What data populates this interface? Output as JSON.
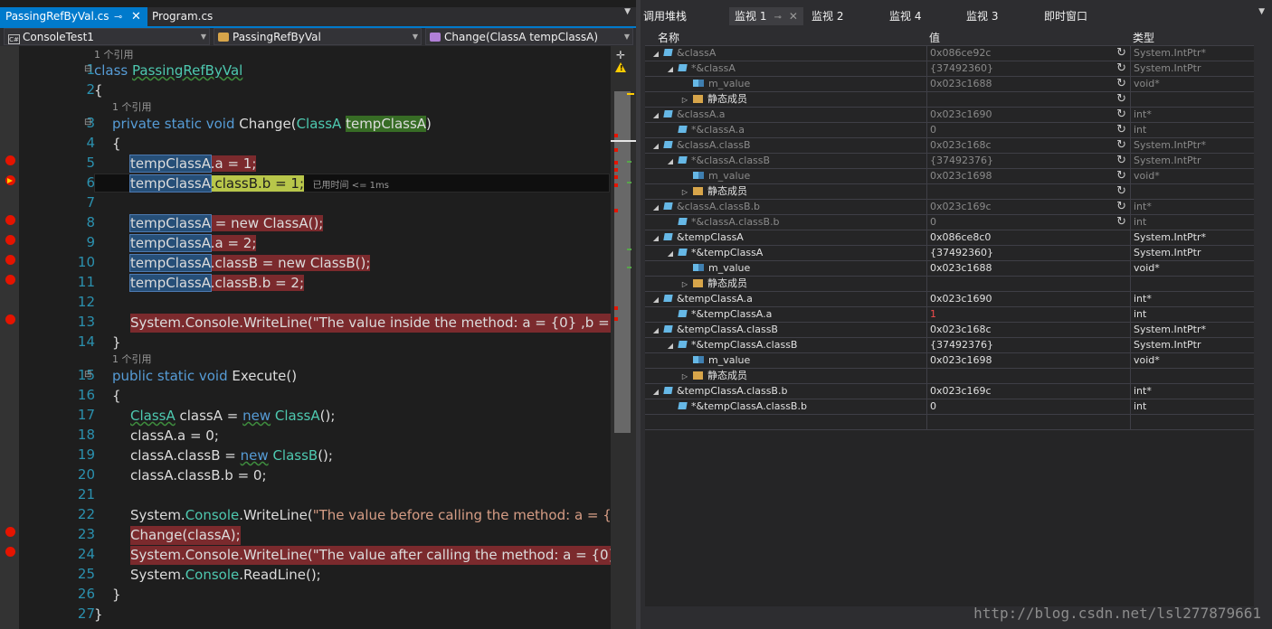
{
  "editor": {
    "tabs": [
      {
        "label": "PassingRefByVal.cs",
        "active": true
      },
      {
        "label": "Program.cs",
        "active": false
      }
    ],
    "tab_pin_icon": "pin-icon",
    "tab_close_icon": "close-icon",
    "nav": {
      "project": "ConsoleTest1",
      "class": "PassingRefByVal",
      "member": "Change(ClassA tempClassA)"
    },
    "ref_hint": "1 个引用",
    "elapsed_hint": "已用时间 <= 1ms",
    "line_numbers": [
      "1",
      "2",
      "3",
      "4",
      "5",
      "6",
      "7",
      "8",
      "9",
      "10",
      "11",
      "12",
      "13",
      "14",
      "15",
      "16",
      "17",
      "18",
      "19",
      "20",
      "21",
      "22",
      "23",
      "24",
      "25",
      "26",
      "27"
    ],
    "code": {
      "l1_kw": "class",
      "l1_name": "PassingRefByVal",
      "brace_open": "{",
      "brace_close": "}",
      "l3_kw": "private static void",
      "l3_method": "Change(",
      "l3_type": "ClassA",
      "l3_param": "tempClassA",
      "l3_end": ")",
      "tmp": "tempClassA",
      "l5_rest": ".a = 1;",
      "l6_rest": ".classB.b = 1;",
      "l8_eq": " = ",
      "l8_new": "new",
      "l8_rest": " ClassA();",
      "l9_rest": ".a = 2;",
      "l10_rest1": ".classB = ",
      "l10_new": "new",
      "l10_rest2": " ClassB();",
      "l11_rest": ".classB.b = 2;",
      "l13": "System.Console.WriteLine(\"The value inside the method: a = {0} ,b = {",
      "l15_kw": "public static void",
      "l15_rest": " Execute()",
      "l17_type": "ClassA",
      "l17_mid": " classA = ",
      "l17_new": "new",
      "l17_type2": "ClassA",
      "l17_end": "();",
      "l18": "classA.a = 0;",
      "l19_a": "classA.classB = ",
      "l19_new": "new",
      "l19_type": "ClassB",
      "l19_end": "();",
      "l20": "classA.classB.b = 0;",
      "l22_sys": "System.",
      "l22_con": "Console",
      "l22_mid": ".WriteLine(",
      "l22_str": "\"The value before calling the method: a = {",
      "l23": "Change(classA);",
      "l24": "System.Console.WriteLine(\"The value after calling the method: a = {0}",
      "l25_sys": "System.",
      "l25_con": "Console",
      "l25_end": ".ReadLine();"
    }
  },
  "watch": {
    "tabs": [
      "调用堆栈",
      "监视 1",
      "监视 2",
      "监视 4",
      "监视 3",
      "即时窗口"
    ],
    "active_tab": "监视 1",
    "columns": {
      "name": "名称",
      "value": "值",
      "type": "类型"
    },
    "rows": [
      {
        "name": "&classA",
        "value": "0x086ce92c",
        "type": "System.IntPtr*",
        "indent": 0,
        "exp": "open",
        "icon": "obj",
        "dim": true,
        "refresh": true
      },
      {
        "name": "*&classA",
        "value": "{37492360}",
        "type": "System.IntPtr",
        "indent": 1,
        "exp": "open",
        "icon": "obj",
        "dim": true,
        "refresh": true
      },
      {
        "name": "m_value",
        "value": "0x023c1688",
        "type": "void*",
        "indent": 2,
        "exp": "none",
        "icon": "fld",
        "dim": true,
        "refresh": true
      },
      {
        "name": "静态成员",
        "value": "",
        "type": "",
        "indent": 2,
        "exp": "closed",
        "icon": "stat",
        "dim": false,
        "refresh": true
      },
      {
        "name": "&classA.a",
        "value": "0x023c1690",
        "type": "int*",
        "indent": 0,
        "exp": "open",
        "icon": "obj",
        "dim": true,
        "refresh": true
      },
      {
        "name": "*&classA.a",
        "value": "0",
        "type": "int",
        "indent": 1,
        "exp": "none",
        "icon": "obj",
        "dim": true,
        "refresh": true
      },
      {
        "name": "&classA.classB",
        "value": "0x023c168c",
        "type": "System.IntPtr*",
        "indent": 0,
        "exp": "open",
        "icon": "obj",
        "dim": true,
        "refresh": true
      },
      {
        "name": "*&classA.classB",
        "value": "{37492376}",
        "type": "System.IntPtr",
        "indent": 1,
        "exp": "open",
        "icon": "obj",
        "dim": true,
        "refresh": true
      },
      {
        "name": "m_value",
        "value": "0x023c1698",
        "type": "void*",
        "indent": 2,
        "exp": "none",
        "icon": "fld",
        "dim": true,
        "refresh": true
      },
      {
        "name": "静态成员",
        "value": "",
        "type": "",
        "indent": 2,
        "exp": "closed",
        "icon": "stat",
        "dim": false,
        "refresh": true
      },
      {
        "name": "&classA.classB.b",
        "value": "0x023c169c",
        "type": "int*",
        "indent": 0,
        "exp": "open",
        "icon": "obj",
        "dim": true,
        "refresh": true
      },
      {
        "name": "*&classA.classB.b",
        "value": "0",
        "type": "int",
        "indent": 1,
        "exp": "none",
        "icon": "obj",
        "dim": true,
        "refresh": true
      },
      {
        "name": "&tempClassA",
        "value": "0x086ce8c0",
        "type": "System.IntPtr*",
        "indent": 0,
        "exp": "open",
        "icon": "obj",
        "dim": false,
        "refresh": false
      },
      {
        "name": "*&tempClassA",
        "value": "{37492360}",
        "type": "System.IntPtr",
        "indent": 1,
        "exp": "open",
        "icon": "obj",
        "dim": false,
        "refresh": false
      },
      {
        "name": "m_value",
        "value": "0x023c1688",
        "type": "void*",
        "indent": 2,
        "exp": "none",
        "icon": "fld",
        "dim": false,
        "refresh": false
      },
      {
        "name": "静态成员",
        "value": "",
        "type": "",
        "indent": 2,
        "exp": "closed",
        "icon": "stat",
        "dim": false,
        "refresh": false
      },
      {
        "name": "&tempClassA.a",
        "value": "0x023c1690",
        "type": "int*",
        "indent": 0,
        "exp": "open",
        "icon": "obj",
        "dim": false,
        "refresh": false
      },
      {
        "name": "*&tempClassA.a",
        "value": "1",
        "type": "int",
        "indent": 1,
        "exp": "none",
        "icon": "obj",
        "dim": false,
        "refresh": false,
        "red": true
      },
      {
        "name": "&tempClassA.classB",
        "value": "0x023c168c",
        "type": "System.IntPtr*",
        "indent": 0,
        "exp": "open",
        "icon": "obj",
        "dim": false,
        "refresh": false
      },
      {
        "name": "*&tempClassA.classB",
        "value": "{37492376}",
        "type": "System.IntPtr",
        "indent": 1,
        "exp": "open",
        "icon": "obj",
        "dim": false,
        "refresh": false
      },
      {
        "name": "m_value",
        "value": "0x023c1698",
        "type": "void*",
        "indent": 2,
        "exp": "none",
        "icon": "fld",
        "dim": false,
        "refresh": false
      },
      {
        "name": "静态成员",
        "value": "",
        "type": "",
        "indent": 2,
        "exp": "closed",
        "icon": "stat",
        "dim": false,
        "refresh": false
      },
      {
        "name": "&tempClassA.classB.b",
        "value": "0x023c169c",
        "type": "int*",
        "indent": 0,
        "exp": "open",
        "icon": "obj",
        "dim": false,
        "refresh": false
      },
      {
        "name": "*&tempClassA.classB.b",
        "value": "0",
        "type": "int",
        "indent": 1,
        "exp": "none",
        "icon": "obj",
        "dim": false,
        "refresh": false
      }
    ]
  },
  "watermark": "http://blog.csdn.net/lsl277879661",
  "colors": {
    "accent": "#007acc",
    "breakpoint": "#e51400",
    "changed_value": "#f14c4c"
  }
}
